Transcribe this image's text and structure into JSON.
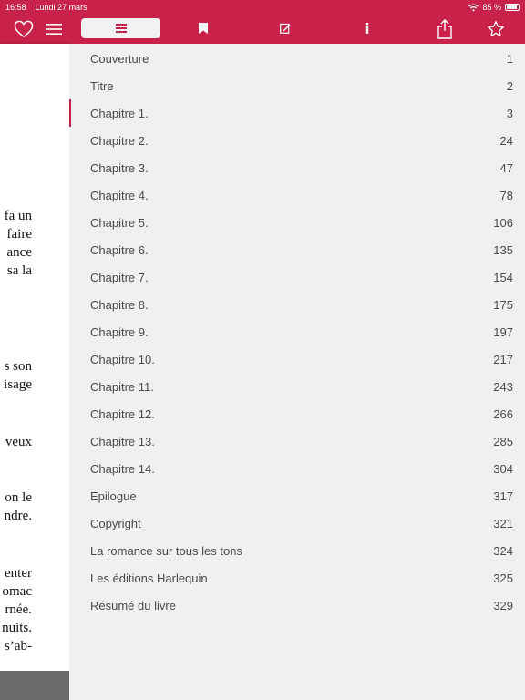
{
  "status": {
    "time": "16:58",
    "date": "Lundi 27 mars",
    "battery": "85 %"
  },
  "toolbar": {
    "icons": [
      "heart-icon",
      "menu-icon",
      "toc-icon",
      "bookmark-icon",
      "note-icon",
      "info-icon",
      "share-icon",
      "star-icon"
    ],
    "active_tab": "toc"
  },
  "colors": {
    "accent": "#c8224a",
    "panel": "#f0f0f0",
    "text": "#4a4a4a"
  },
  "reader_lines": [
    "fa un",
    "faire",
    "ance",
    "sa la",
    "s son",
    "isage",
    "veux",
    "on le",
    "ndre.",
    "enter",
    "omac",
    "rnée.",
    "nuits.",
    "s’ab-"
  ],
  "toc": {
    "current_index": 2,
    "entries": [
      {
        "title": "Couverture",
        "page": "1"
      },
      {
        "title": "Titre",
        "page": "2"
      },
      {
        "title": "Chapitre 1.",
        "page": "3"
      },
      {
        "title": "Chapitre 2.",
        "page": "24"
      },
      {
        "title": "Chapitre 3.",
        "page": "47"
      },
      {
        "title": "Chapitre 4.",
        "page": "78"
      },
      {
        "title": "Chapitre 5.",
        "page": "106"
      },
      {
        "title": "Chapitre 6.",
        "page": "135"
      },
      {
        "title": "Chapitre 7.",
        "page": "154"
      },
      {
        "title": "Chapitre 8.",
        "page": "175"
      },
      {
        "title": "Chapitre 9.",
        "page": "197"
      },
      {
        "title": "Chapitre 10.",
        "page": "217"
      },
      {
        "title": "Chapitre 11.",
        "page": "243"
      },
      {
        "title": "Chapitre 12.",
        "page": "266"
      },
      {
        "title": "Chapitre 13.",
        "page": "285"
      },
      {
        "title": "Chapitre 14.",
        "page": "304"
      },
      {
        "title": "Epilogue",
        "page": "317"
      },
      {
        "title": "Copyright",
        "page": "321"
      },
      {
        "title": "La romance sur tous les tons",
        "page": "324"
      },
      {
        "title": "Les éditions Harlequin",
        "page": "325"
      },
      {
        "title": "Résumé du livre",
        "page": "329"
      }
    ]
  }
}
